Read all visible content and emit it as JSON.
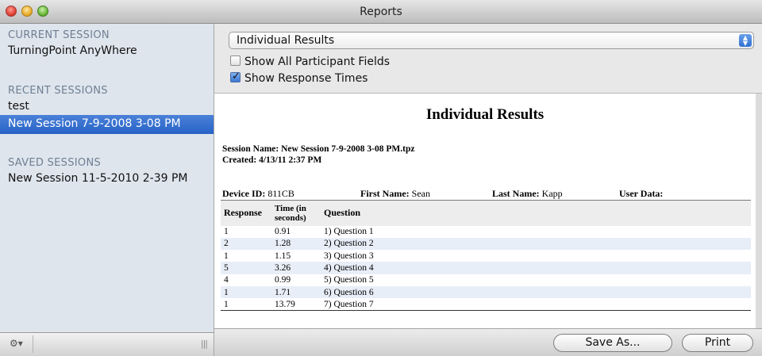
{
  "window": {
    "title": "Reports"
  },
  "sidebar": {
    "current_heading": "CURRENT SESSION",
    "current_item": "TurningPoint AnyWhere",
    "recent_heading": "RECENT SESSIONS",
    "recent_items": [
      "test",
      "New Session 7-9-2008 3-08 PM"
    ],
    "saved_heading": "SAVED SESSIONS",
    "saved_items": [
      "New Session 11-5-2010 2-39 PM"
    ],
    "bottom_gear_icon": "gear-icon",
    "bottom_grip": "|||"
  },
  "controls": {
    "report_type": "Individual Results",
    "show_all_fields_label": "Show All Participant Fields",
    "show_all_fields_checked": false,
    "show_response_times_label": "Show Response Times",
    "show_response_times_checked": true
  },
  "report": {
    "title": "Individual Results",
    "session_name": "Session Name: New Session 7-9-2008 3-08 PM.tpz",
    "created": "Created: 4/13/11 2:37 PM",
    "device_id_label": "Device ID:",
    "device_id": "811CB",
    "first_name_label": "First Name:",
    "first_name": "Sean",
    "last_name_label": "Last Name:",
    "last_name": "Kapp",
    "user_data_label": "User Data:",
    "columns": [
      "Response",
      "Time (in seconds)",
      "Question"
    ],
    "rows": [
      {
        "response": "1",
        "time": "0.91",
        "question": "1) Question 1"
      },
      {
        "response": "2",
        "time": "1.28",
        "question": "2) Question 2"
      },
      {
        "response": "1",
        "time": "1.15",
        "question": "3) Question 3"
      },
      {
        "response": "5",
        "time": "3.26",
        "question": "4) Question 4"
      },
      {
        "response": "4",
        "time": "0.99",
        "question": "5) Question 5"
      },
      {
        "response": "1",
        "time": "1.71",
        "question": "6) Question 6"
      },
      {
        "response": "1",
        "time": "13.79",
        "question": "7) Question 7"
      }
    ]
  },
  "buttons": {
    "save_as": "Save As...",
    "print": "Print"
  }
}
